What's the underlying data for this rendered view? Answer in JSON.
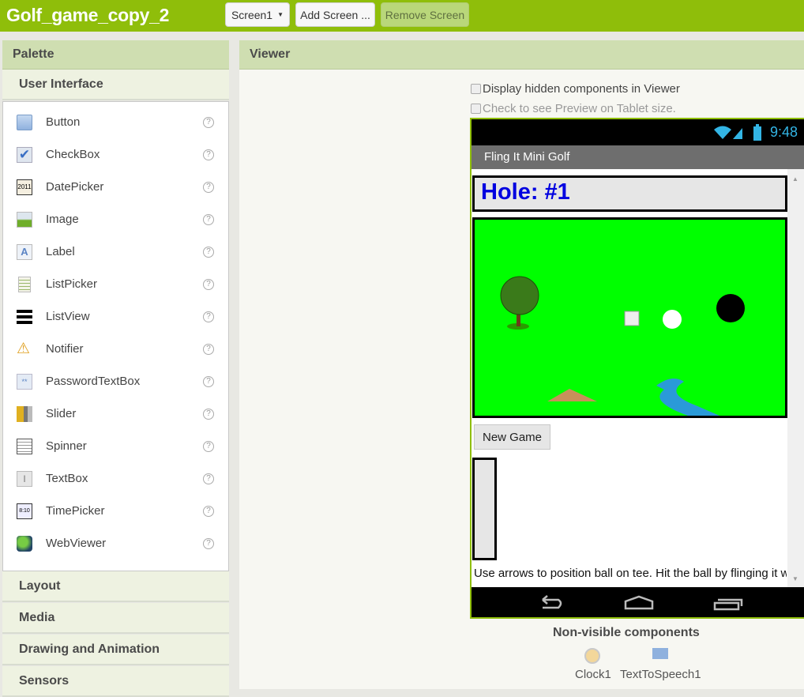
{
  "app": {
    "title": "Golf_game_copy_2"
  },
  "toolbar": {
    "screen_select": "Screen1",
    "add_screen": "Add Screen ...",
    "remove_screen": "Remove Screen"
  },
  "palette": {
    "title": "Palette",
    "category_open": "User Interface",
    "items": [
      {
        "label": "Button",
        "icon": "button-icon"
      },
      {
        "label": "CheckBox",
        "icon": "checkbox-icon"
      },
      {
        "label": "DatePicker",
        "icon": "datepicker-icon"
      },
      {
        "label": "Image",
        "icon": "image-icon"
      },
      {
        "label": "Label",
        "icon": "label-icon"
      },
      {
        "label": "ListPicker",
        "icon": "listpicker-icon"
      },
      {
        "label": "ListView",
        "icon": "listview-icon"
      },
      {
        "label": "Notifier",
        "icon": "notifier-icon"
      },
      {
        "label": "PasswordTextBox",
        "icon": "password-icon"
      },
      {
        "label": "Slider",
        "icon": "slider-icon"
      },
      {
        "label": "Spinner",
        "icon": "spinner-icon"
      },
      {
        "label": "TextBox",
        "icon": "textbox-icon"
      },
      {
        "label": "TimePicker",
        "icon": "timepicker-icon"
      },
      {
        "label": "WebViewer",
        "icon": "webviewer-icon"
      }
    ],
    "help": "?",
    "categories": [
      "Layout",
      "Media",
      "Drawing and Animation",
      "Sensors"
    ]
  },
  "viewer": {
    "title": "Viewer",
    "display_hidden": "Display hidden components in Viewer",
    "tablet_preview": "Check to see Preview on Tablet size.",
    "phone": {
      "time": "9:48",
      "app_title": "Fling It Mini Golf",
      "hole_label": "Hole: #1",
      "new_game": "New Game",
      "instructions": "Use arrows to position ball on tee. Hit the ball by flinging it with your finger."
    },
    "non_visible": {
      "title": "Non-visible components",
      "items": [
        "Clock1",
        "TextToSpeech1"
      ]
    }
  },
  "colors": {
    "topbar": "#8fbe0a",
    "canvas": "#00ff00",
    "hole_text": "#0000e0"
  }
}
